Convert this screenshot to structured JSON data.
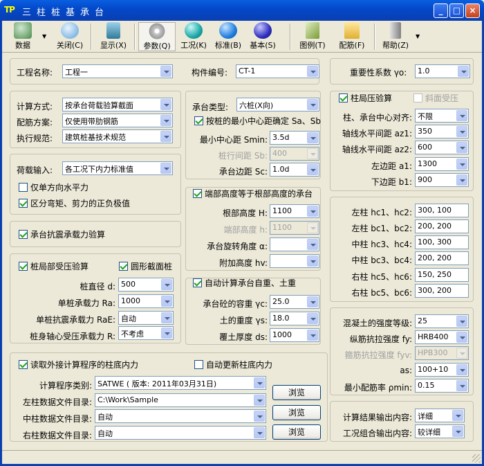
{
  "title": {
    "app_icon": "TP",
    "text": "三柱桩基承台"
  },
  "window_buttons": {
    "minimize": "_",
    "maximize": "□",
    "close": "×"
  },
  "toolbar": [
    {
      "label": "数据",
      "icon": "database-icon",
      "color": "#4a8a4a"
    },
    {
      "label": "关闭(C)",
      "icon": "close-gear-icon",
      "color": "#5aa0d8"
    },
    {
      "label": "显示(X)",
      "icon": "display-icon",
      "color": "#2f7a9a"
    },
    {
      "label": "参数(Q)",
      "icon": "cd-icon",
      "color": "#c8c8c8"
    },
    {
      "label": "工况(K)",
      "icon": "teal-ball-icon",
      "color": "#1ea8a8"
    },
    {
      "label": "标准(B)",
      "icon": "blue-ball-icon",
      "color": "#2080e0"
    },
    {
      "label": "基本(S)",
      "icon": "indigo-ball-icon",
      "color": "#3030c0"
    },
    {
      "label": "图例(T)",
      "icon": "image-icon",
      "color": "#7a9a3a"
    },
    {
      "label": "配筋(F)",
      "icon": "folder-gear-icon",
      "color": "#e0b030"
    },
    {
      "label": "帮助(Z)",
      "icon": "help-book-icon",
      "color": "#808080"
    }
  ],
  "p1": {
    "project_label": "工程名称:",
    "project_value": "工程一",
    "member_label": "构件编号:",
    "member_value": "CT-1"
  },
  "p_importance": {
    "label": "重要性系数 γo:",
    "value": "1.0"
  },
  "p2": {
    "calc_label": "计算方式:",
    "calc_value": "按承台荷载验算截面",
    "rebar_label": "配筋方案:",
    "rebar_value": "仅使用带肋钢筋",
    "code_label": "执行规范:",
    "code_value": "建筑桩基技术规范"
  },
  "p3": {
    "load_label": "荷载输入:",
    "load_value": "各工况下内力标准值",
    "chk1": "仅单方向水平力",
    "chk2": "区分弯矩、剪力的正负极值"
  },
  "p4": {
    "chk": "承台抗震承载力验算"
  },
  "p5": {
    "chk_local": "桩局部受压验算",
    "chk_round": "圆形截面桩",
    "dia_label": "桩直径 d:",
    "dia_value": "500",
    "ra_label": "单桩承载力 Ra:",
    "ra_value": "1000",
    "rae_label": "单桩抗震承载力 RaE:",
    "rae_value": "自动",
    "r_label": "桩身轴心受压承载力 R:",
    "r_value": "不考虑"
  },
  "p6": {
    "type_label": "承台类型:",
    "type_value": "六桩(X向)",
    "chk_min": "按桩的最小中心距确定 Sa、Sb",
    "smin_label": "最小中心距 Smin:",
    "smin_value": "3.5d",
    "sb_label": "桩行间距 Sb:",
    "sb_value": "400",
    "sc_label": "承台边距 Sc:",
    "sc_value": "1.0d"
  },
  "p7": {
    "chk": "端部高度等于根部高度的承台",
    "h_label": "根部高度 H:",
    "h_value": "1100",
    "he_label": "端部高度 h:",
    "he_value": "1100",
    "rot_label": "承台旋转角度 α:",
    "rot_value": "",
    "hv_label": "附加高度 hv:",
    "hv_value": ""
  },
  "p8": {
    "chk": "自动计算承台自重、土重",
    "gc_label": "承台砼的容重 γc:",
    "gc_value": "25.0",
    "gs_label": "土的重度 γs:",
    "gs_value": "18.0",
    "ds_label": "覆土厚度 ds:",
    "ds_value": "1000"
  },
  "p9": {
    "chk_local": "柱局压验算",
    "chk_slope": "斜面受压",
    "align_label": "柱、承台中心对齐:",
    "align_value": "不限",
    "az1_label": "轴线水平间距 az1:",
    "az1_value": "350",
    "az2_label": "轴线水平间距 az2:",
    "az2_value": "600",
    "a1_label": "左边距 a1:",
    "a1_value": "1300",
    "b1_label": "下边距 b1:",
    "b1_value": "900"
  },
  "p10": {
    "rows": [
      {
        "label": "左柱 hc1、hc2:",
        "value": "300, 100"
      },
      {
        "label": "左柱 bc1、bc2:",
        "value": "200, 200"
      },
      {
        "label": "中柱 hc3、hc4:",
        "value": "100, 300"
      },
      {
        "label": "中柱 bc3、bc4:",
        "value": "200, 200"
      },
      {
        "label": "右柱 hc5、hc6:",
        "value": "150, 250"
      },
      {
        "label": "右柱 bc5、bc6:",
        "value": "300, 200"
      }
    ]
  },
  "p11": {
    "conc_label": "混凝土的强度等级:",
    "conc_value": "25",
    "fy_label": "纵筋抗拉强度 fy:",
    "fy_value": "HRB400",
    "fyv_label": "箍筋抗拉强度 fyv:",
    "fyv_value": "HPB300",
    "as_label": "as:",
    "as_value": "100+10",
    "pmin_label": "最小配筋率 ρmin:",
    "pmin_value": "0.15"
  },
  "p12": {
    "chk_read": "读取外接计算程序的柱底内力",
    "chk_auto": "自动更新柱底内力",
    "prog_label": "计算程序类别:",
    "prog_value": "SATWE ( 版本: 2011年03月31日)",
    "left_label": "左柱数据文件目录:",
    "left_value": "C:\\Work\\Sample",
    "mid_label": "中柱数据文件目录:",
    "mid_value": "自动",
    "right_label": "右柱数据文件目录:",
    "right_value": "自动",
    "browse": "浏览"
  },
  "p13": {
    "res_label": "计算结果输出内容:",
    "res_value": "详细",
    "comb_label": "工况组合输出内容:",
    "comb_value": "较详细"
  }
}
